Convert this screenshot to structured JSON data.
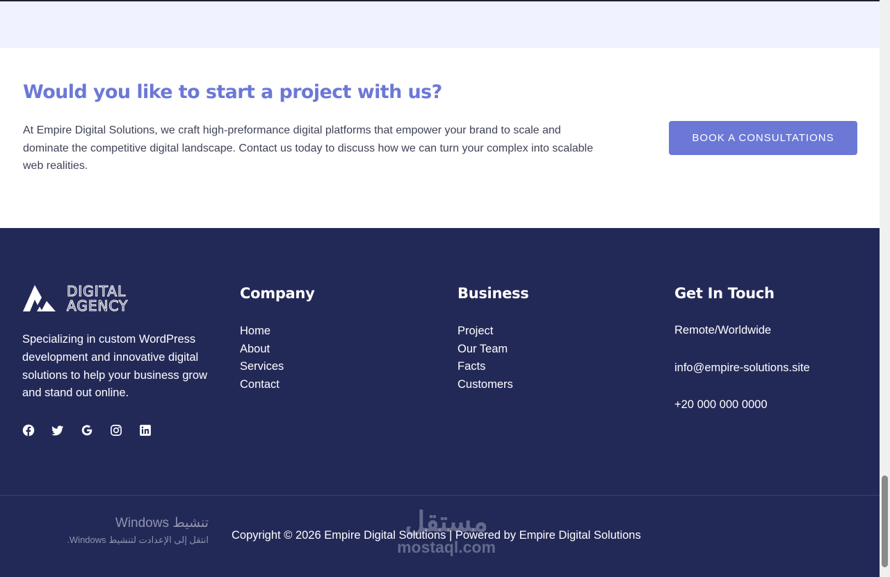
{
  "cta": {
    "title": "Would you like to start a project with us?",
    "description": "At Empire Digital Solutions, we craft high-preformance digital platforms that empower your brand to scale and dominate the competitive digital landscape. Contact us today to discuss how we can turn your complex into scalable web realities.",
    "button_label": "BOOK A CONSULTATIONS"
  },
  "footer": {
    "logo": {
      "line1": "DIGITAL",
      "line2": "AGENCY"
    },
    "about": "Specializing in custom WordPress development and innovative digital solutions to help your business grow and stand out online.",
    "social_icons": [
      "facebook-icon",
      "twitter-icon",
      "google-icon",
      "instagram-icon",
      "linkedin-icon"
    ],
    "company": {
      "title": "Company",
      "links": [
        "Home",
        "About",
        "Services",
        "Contact"
      ]
    },
    "business": {
      "title": "Business",
      "links": [
        "Project",
        "Our Team",
        "Facts",
        "Customers"
      ]
    },
    "contact": {
      "title": "Get In Touch",
      "location": "Remote/Worldwide",
      "email": "info@empire-solutions.site",
      "phone": "+20 000 000 0000"
    },
    "copyright": "Copyright © 2026 Empire Digital Solutions | Powered by Empire Digital Solutions"
  },
  "overlays": {
    "windows_activation_title": "تنشيط Windows",
    "windows_activation_subtitle": "انتقل إلى الإعدادت لتنشيط Windows.",
    "watermark_arabic": "مستقل",
    "watermark_url": "mostaql.com"
  },
  "colors": {
    "accent": "#6b78d6",
    "footer_background": "#232957",
    "band_background": "#f1f2ff",
    "body_text": "#3f4258"
  }
}
